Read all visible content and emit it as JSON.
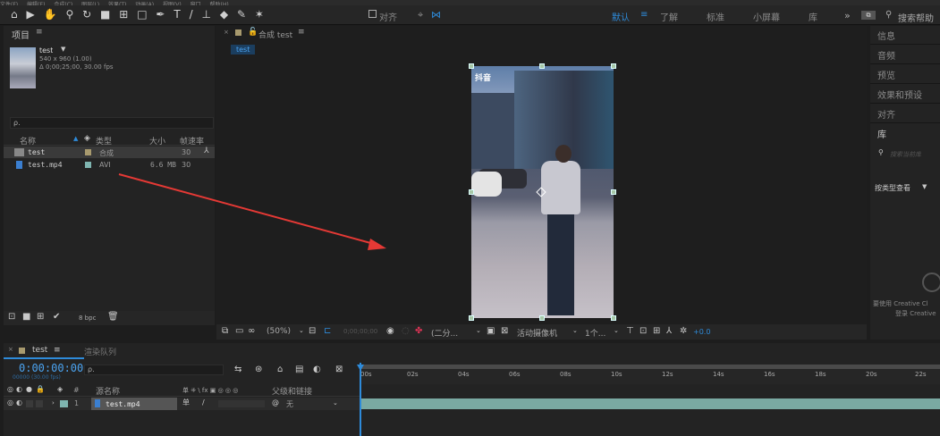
{
  "menubar": {
    "items": [
      "文件(F)",
      "编辑(E)",
      "合成(C)",
      "图层(L)",
      "效果(T)",
      "动画(A)",
      "视图(V)",
      "窗口",
      "帮助(H)"
    ]
  },
  "toolbar": {
    "snap_label": "对齐",
    "workspaces": [
      "默认",
      "了解",
      "标准",
      "小屏幕",
      "库"
    ],
    "active_workspace": "默认",
    "search_placeholder": "搜索帮助"
  },
  "project": {
    "tab": "项目",
    "comp_name": "test",
    "comp_dims": "540 x 960 (1.00)",
    "comp_duration": "Δ 0;00;25;00, 30.00 fps",
    "search_placeholder": "ρ.",
    "columns": [
      "名称",
      "类型",
      "大小",
      "帧速率"
    ],
    "rows": [
      {
        "name": "test",
        "type": "合成",
        "size": "",
        "fps": "30",
        "swatch": "#a89a6e"
      },
      {
        "name": "test.mp4",
        "type": "AVI",
        "size": "6.6 MB",
        "fps": "30",
        "swatch": "#7fb5b0"
      }
    ],
    "bpc": "8 bpc"
  },
  "viewer": {
    "tab_label": "合成 test",
    "breadcrumb": "test",
    "zoom": "(50%)",
    "timecode": "0;00;00;00",
    "resolution": "(二分...",
    "camera": "活动摄像机",
    "views": "1个...",
    "exposure": "+0.0",
    "watermark": "抖音"
  },
  "right_panel": {
    "items": [
      "信息",
      "音频",
      "预览",
      "效果和预设",
      "对齐",
      "库"
    ],
    "search_placeholder": "搜索当前库",
    "view_by": "按类型查看",
    "cc_text1": "要使用 Creative Cl",
    "cc_text2": "登录 Creative"
  },
  "timeline": {
    "tab": "test",
    "render_queue": "渲染队列",
    "timecode": "0:00:00:00",
    "sub_timecode": "00000 (30.00 fps)",
    "search_placeholder": "ρ.",
    "col_source": "源名称",
    "col_parent": "父级和链接",
    "layer": {
      "index": "1",
      "name": "test.mp4",
      "parent": "无"
    },
    "ticks": [
      "00s",
      "02s",
      "04s",
      "06s",
      "08s",
      "10s",
      "12s",
      "14s",
      "16s",
      "18s",
      "20s",
      "22s"
    ]
  },
  "colors": {
    "accent": "#2e8bda",
    "annotation_arrow": "#e53935",
    "layer_bar": "#7aa9a2"
  }
}
